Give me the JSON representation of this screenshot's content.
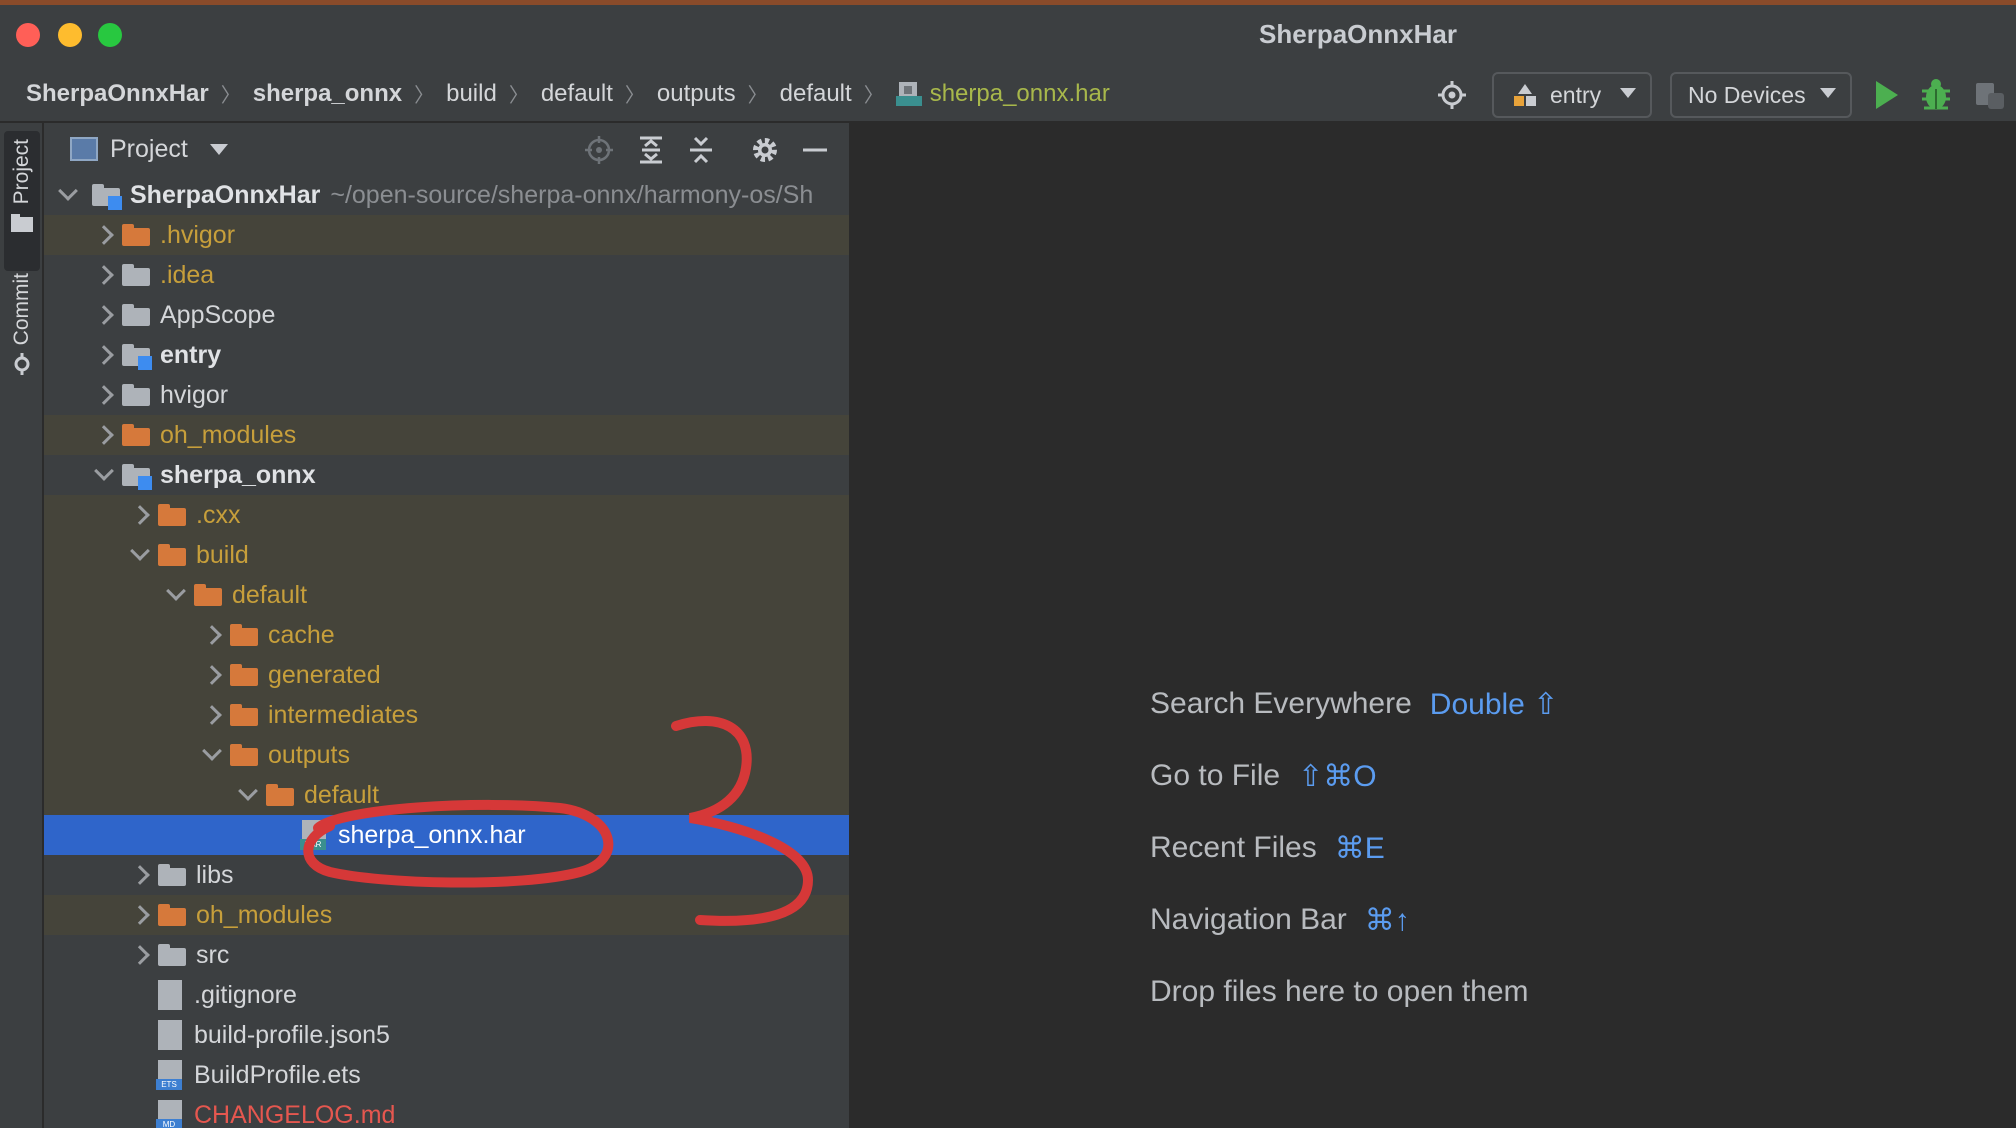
{
  "window": {
    "title": "SherpaOnnxHar"
  },
  "breadcrumb": {
    "items": [
      {
        "label": "SherpaOnnxHar",
        "bold": true
      },
      {
        "label": "sherpa_onnx",
        "bold": true
      },
      {
        "label": "build"
      },
      {
        "label": "default"
      },
      {
        "label": "outputs"
      },
      {
        "label": "default"
      },
      {
        "label": "sherpa_onnx.har",
        "icon": "har-file-icon"
      }
    ]
  },
  "toolbar": {
    "run_config": "entry",
    "device": "No Devices",
    "icons": [
      "target-icon",
      "play-icon",
      "debug-bug-icon",
      "attach-debugger-icon"
    ],
    "colors": {
      "run": "#4caf50",
      "debug": "#4caf50"
    }
  },
  "sidebar": {
    "tabs": [
      {
        "label": "Project",
        "icon": "folder-icon"
      },
      {
        "label": "Commit",
        "icon": "commit-icon"
      }
    ]
  },
  "project_panel": {
    "title": "Project",
    "header_icons": [
      "locate-icon",
      "expand-all-icon",
      "collapse-all-icon",
      "gear-icon",
      "minimize-icon"
    ],
    "root": {
      "label": "SherpaOnnxHar",
      "path": "~/open-source/sherpa-onnx/harmony-os/Sh"
    },
    "tree": [
      {
        "label": ".hvigor",
        "kind": "folder-orange",
        "depth": 1,
        "state": "collapsed",
        "excluded": true
      },
      {
        "label": ".idea",
        "kind": "folder-gray",
        "depth": 1,
        "state": "collapsed",
        "style": "orange"
      },
      {
        "label": "AppScope",
        "kind": "folder-gray",
        "depth": 1,
        "state": "collapsed"
      },
      {
        "label": "entry",
        "kind": "module",
        "depth": 1,
        "state": "collapsed",
        "bold": true
      },
      {
        "label": "hvigor",
        "kind": "folder-gray",
        "depth": 1,
        "state": "collapsed"
      },
      {
        "label": "oh_modules",
        "kind": "folder-orange",
        "depth": 1,
        "state": "collapsed",
        "excluded": true
      },
      {
        "label": "sherpa_onnx",
        "kind": "module",
        "depth": 1,
        "state": "expanded",
        "bold": true
      },
      {
        "label": ".cxx",
        "kind": "folder-orange",
        "depth": 2,
        "state": "collapsed",
        "excluded": true
      },
      {
        "label": "build",
        "kind": "folder-orange",
        "depth": 2,
        "state": "expanded",
        "excluded": true
      },
      {
        "label": "default",
        "kind": "folder-orange",
        "depth": 3,
        "state": "expanded",
        "excluded": true
      },
      {
        "label": "cache",
        "kind": "folder-orange",
        "depth": 4,
        "state": "collapsed",
        "excluded": true
      },
      {
        "label": "generated",
        "kind": "folder-orange",
        "depth": 4,
        "state": "collapsed",
        "excluded": true
      },
      {
        "label": "intermediates",
        "kind": "folder-orange",
        "depth": 4,
        "state": "collapsed",
        "excluded": true
      },
      {
        "label": "outputs",
        "kind": "folder-orange",
        "depth": 4,
        "state": "expanded",
        "excluded": true
      },
      {
        "label": "default",
        "kind": "folder-orange",
        "depth": 5,
        "state": "expanded",
        "excluded": true
      },
      {
        "label": "sherpa_onnx.har",
        "kind": "har",
        "depth": 6,
        "state": "leaf",
        "selected": true
      },
      {
        "label": "libs",
        "kind": "folder-gray",
        "depth": 2,
        "state": "collapsed"
      },
      {
        "label": "oh_modules",
        "kind": "folder-orange",
        "depth": 2,
        "state": "collapsed",
        "excluded": true
      },
      {
        "label": "src",
        "kind": "folder-gray",
        "depth": 2,
        "state": "collapsed"
      },
      {
        "label": ".gitignore",
        "kind": "file",
        "depth": 2,
        "state": "leaf"
      },
      {
        "label": "build-profile.json5",
        "kind": "file",
        "depth": 2,
        "state": "leaf"
      },
      {
        "label": "BuildProfile.ets",
        "kind": "file-ets",
        "depth": 2,
        "state": "leaf"
      },
      {
        "label": "CHANGELOG.md",
        "kind": "file-md",
        "depth": 2,
        "state": "leaf",
        "style": "red"
      }
    ]
  },
  "editor": {
    "hints": [
      {
        "label": "Search Everywhere",
        "key": "Double ⇧"
      },
      {
        "label": "Go to File",
        "key": "⇧⌘O"
      },
      {
        "label": "Recent Files",
        "key": "⌘E"
      },
      {
        "label": "Navigation Bar",
        "key": "⌘↑"
      },
      {
        "label": "Drop files here to open them",
        "key": ""
      }
    ],
    "colors": {
      "key": "#5b9cf0"
    }
  },
  "annotation": {
    "label": "3",
    "color": "#d63838"
  }
}
